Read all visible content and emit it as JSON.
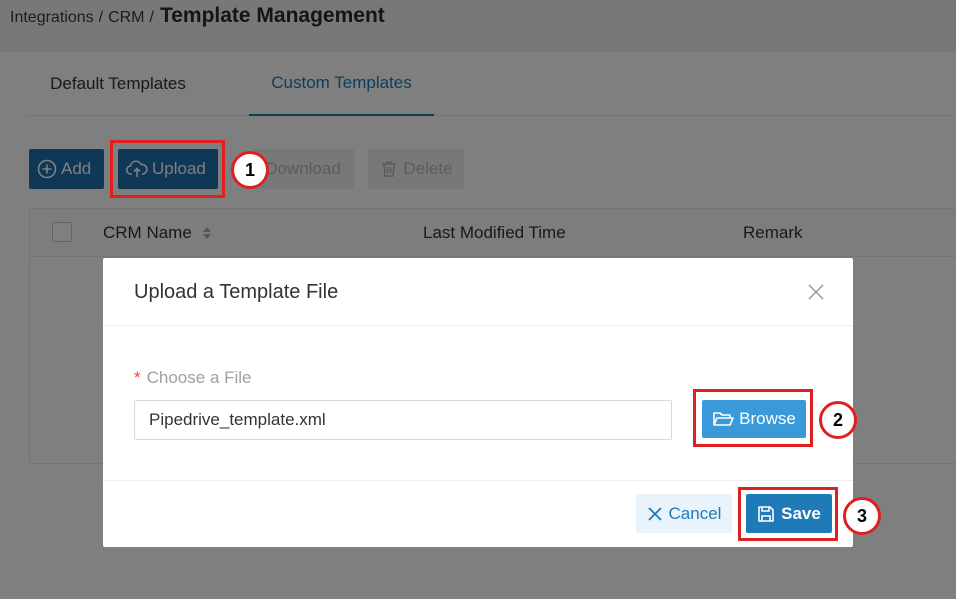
{
  "breadcrumb": {
    "items": [
      "Integrations",
      "CRM"
    ],
    "separator": "/",
    "title": "Template Management"
  },
  "tabs": [
    {
      "label": "Default Templates",
      "active": false
    },
    {
      "label": "Custom Templates",
      "active": true
    }
  ],
  "toolbar": {
    "add_label": "Add",
    "upload_label": "Upload",
    "download_label": "Download",
    "delete_label": "Delete"
  },
  "table": {
    "columns": [
      "CRM Name",
      "Last Modified Time",
      "Remark"
    ]
  },
  "modal": {
    "title": "Upload a Template File",
    "required_mark": "*",
    "field_label": "Choose a File",
    "file_value": "Pipedrive_template.xml",
    "browse_label": "Browse",
    "cancel_label": "Cancel",
    "save_label": "Save"
  },
  "annotations": {
    "step_1": "1",
    "step_2": "2",
    "step_3": "3"
  },
  "colors": {
    "primary": "#1f7ab8",
    "toolbar_primary": "#1f6fad",
    "browse": "#3a9ad9",
    "highlight": "#e02020",
    "required": "#e04b3a"
  }
}
